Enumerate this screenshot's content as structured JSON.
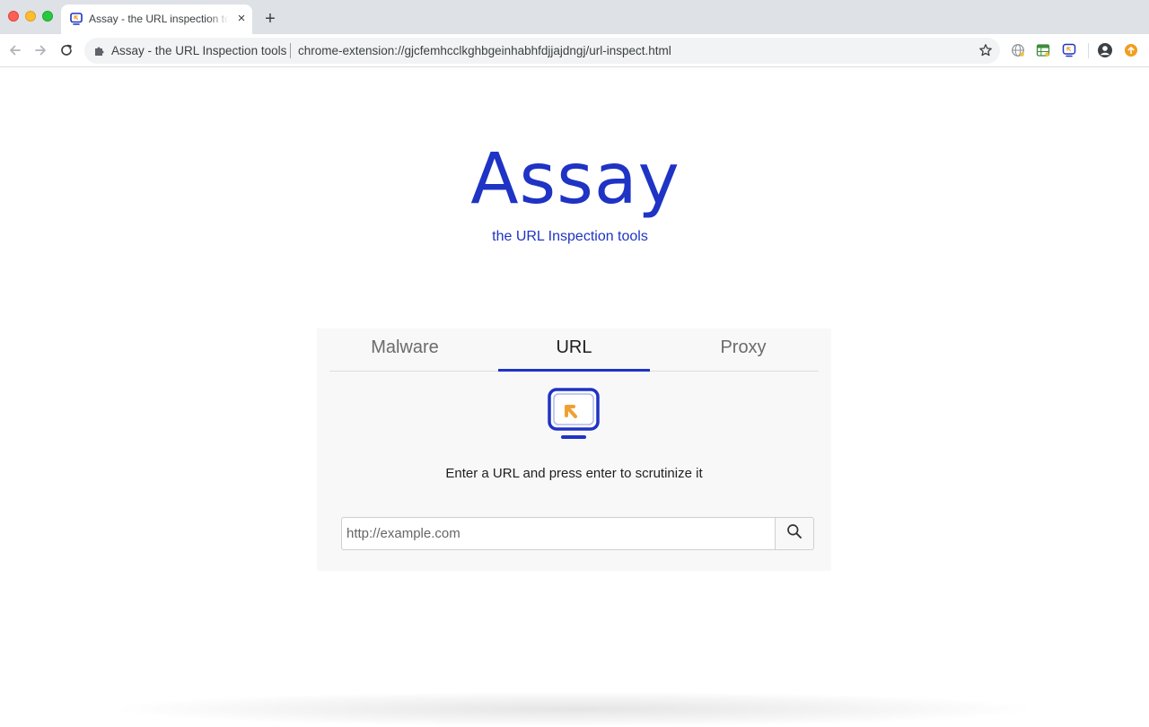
{
  "browser": {
    "tab": {
      "title": "Assay - the URL inspection tools",
      "close_glyph": "×",
      "favicon": "assay-favicon-icon"
    },
    "new_tab_glyph": "+",
    "toolbar": {
      "back_icon": "back-arrow-icon",
      "forward_icon": "forward-arrow-icon",
      "reload_icon": "reload-icon"
    },
    "omnibox": {
      "extension_name": "Assay - the URL Inspection tools",
      "url": "chrome-extension://gjcfemhcclkghbgeinhabhfdjjajdngj/url-inspect.html",
      "bookmark_icon": "star-icon"
    },
    "extensions": [
      "globe-extension-icon",
      "spreadsheet-extension-icon",
      "assay-extension-icon"
    ],
    "profile_icon": "profile-icon",
    "update_icon": "update-badge-icon"
  },
  "page": {
    "brand": {
      "title": "Assay",
      "subtitle": "the URL Inspection tools"
    },
    "tabs": [
      {
        "label": "Malware",
        "active": false
      },
      {
        "label": "URL",
        "active": true
      },
      {
        "label": "Proxy",
        "active": false
      }
    ],
    "instruction": "Enter a URL and press enter to scrutinize it",
    "search": {
      "placeholder": "http://example.com",
      "value": "",
      "button_icon": "search-icon"
    }
  },
  "colors": {
    "brand": "#1f33c4",
    "accent_orange": "#f0a030",
    "panel_bg": "#f8f8f8"
  }
}
